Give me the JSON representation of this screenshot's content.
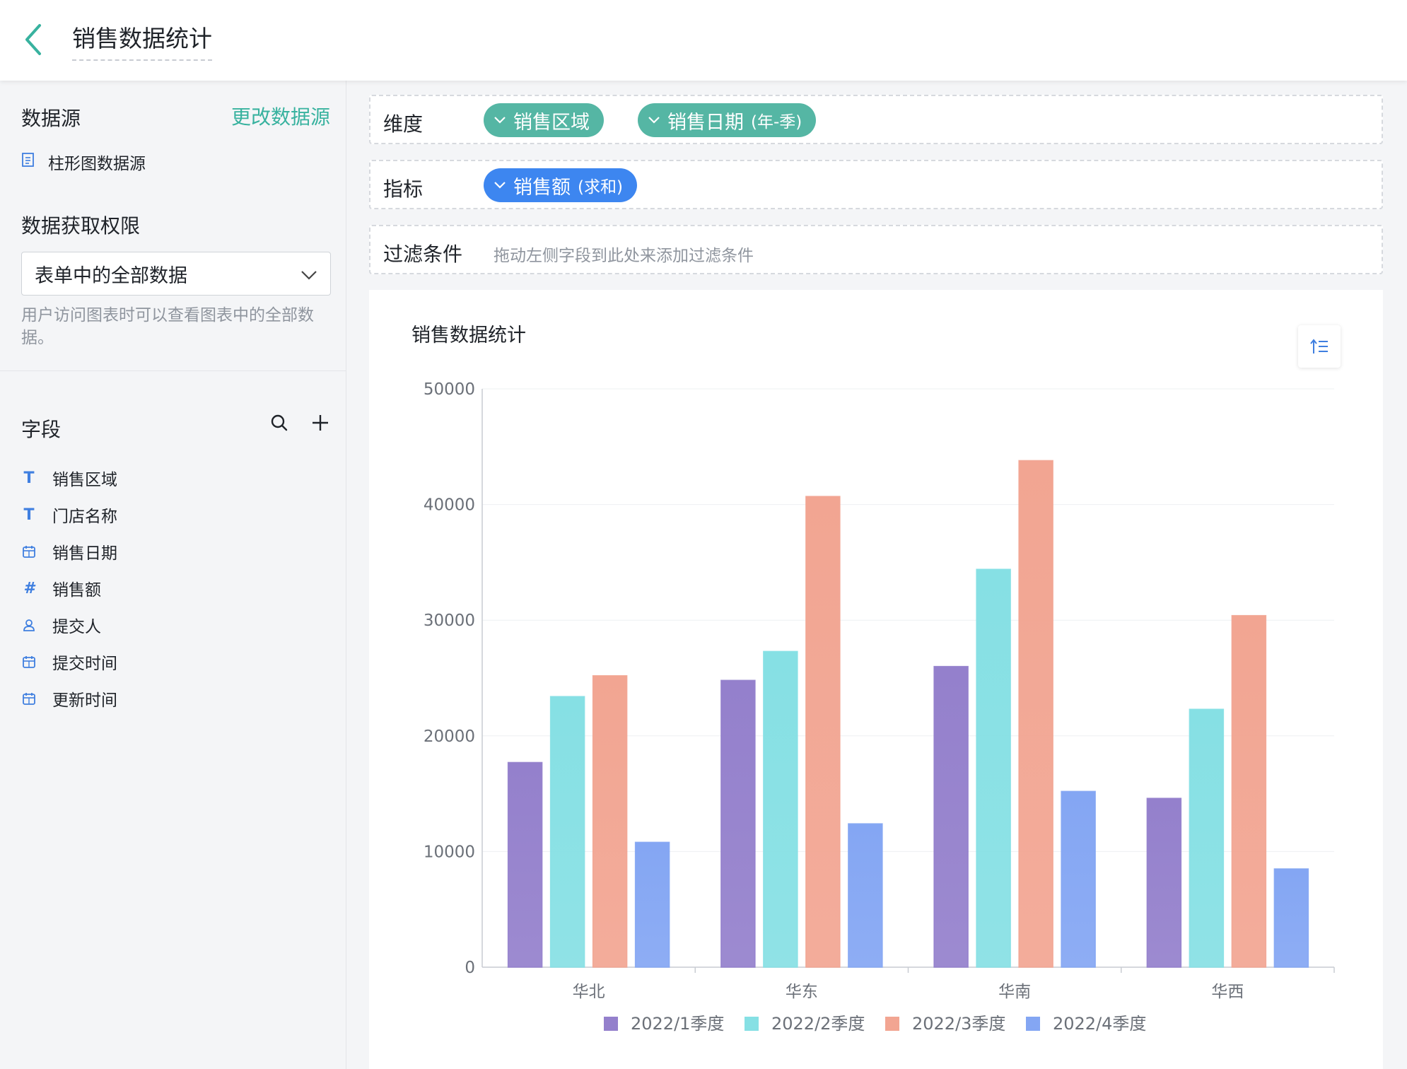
{
  "header": {
    "title": "销售数据统计"
  },
  "sidebar": {
    "datasource_title": "数据源",
    "change_datasource": "更改数据源",
    "datasource_name": "柱形图数据源",
    "permission_title": "数据获取权限",
    "permission_value": "表单中的全部数据",
    "permission_hint": "用户访问图表时可以查看图表中的全部数据。",
    "fields_title": "字段",
    "fields": [
      {
        "label": "销售区域",
        "icon": "text-type-icon"
      },
      {
        "label": "门店名称",
        "icon": "text-type-icon"
      },
      {
        "label": "销售日期",
        "icon": "calendar-icon"
      },
      {
        "label": "销售额",
        "icon": "number-type-icon"
      },
      {
        "label": "提交人",
        "icon": "user-icon"
      },
      {
        "label": "提交时间",
        "icon": "calendar-icon"
      },
      {
        "label": "更新时间",
        "icon": "calendar-icon"
      }
    ]
  },
  "shelves": {
    "dimension_label": "维度",
    "dimension_chips": [
      {
        "main": "销售区域",
        "sub": ""
      },
      {
        "main": "销售日期",
        "sub": "(年-季)"
      }
    ],
    "metric_label": "指标",
    "metric_chip": {
      "main": "销售额",
      "sub": "(求和)"
    },
    "filter_label": "过滤条件",
    "filter_placeholder": "拖动左侧字段到此处来添加过滤条件"
  },
  "colors": {
    "accent": "#38b29f",
    "chip_green": "#55b6a4",
    "chip_blue": "#3d86f0",
    "series": [
      "#9480cc",
      "#86e0e4",
      "#f2a592",
      "#84a6f3"
    ]
  },
  "chart_data": {
    "type": "bar",
    "title": "销售数据统计",
    "categories": [
      "华北",
      "华东",
      "华南",
      "华西"
    ],
    "series": [
      {
        "name": "2022/1季度",
        "values": [
          17700,
          24800,
          26000,
          14600
        ]
      },
      {
        "name": "2022/2季度",
        "values": [
          23400,
          27300,
          34400,
          22300
        ]
      },
      {
        "name": "2022/3季度",
        "values": [
          25200,
          40700,
          43800,
          30400
        ]
      },
      {
        "name": "2022/4季度",
        "values": [
          10800,
          12400,
          15200,
          8500
        ]
      }
    ],
    "ylim": [
      0,
      50000
    ],
    "yticks": [
      0,
      10000,
      20000,
      30000,
      40000,
      50000
    ],
    "grid": true,
    "legend_position": "bottom"
  }
}
